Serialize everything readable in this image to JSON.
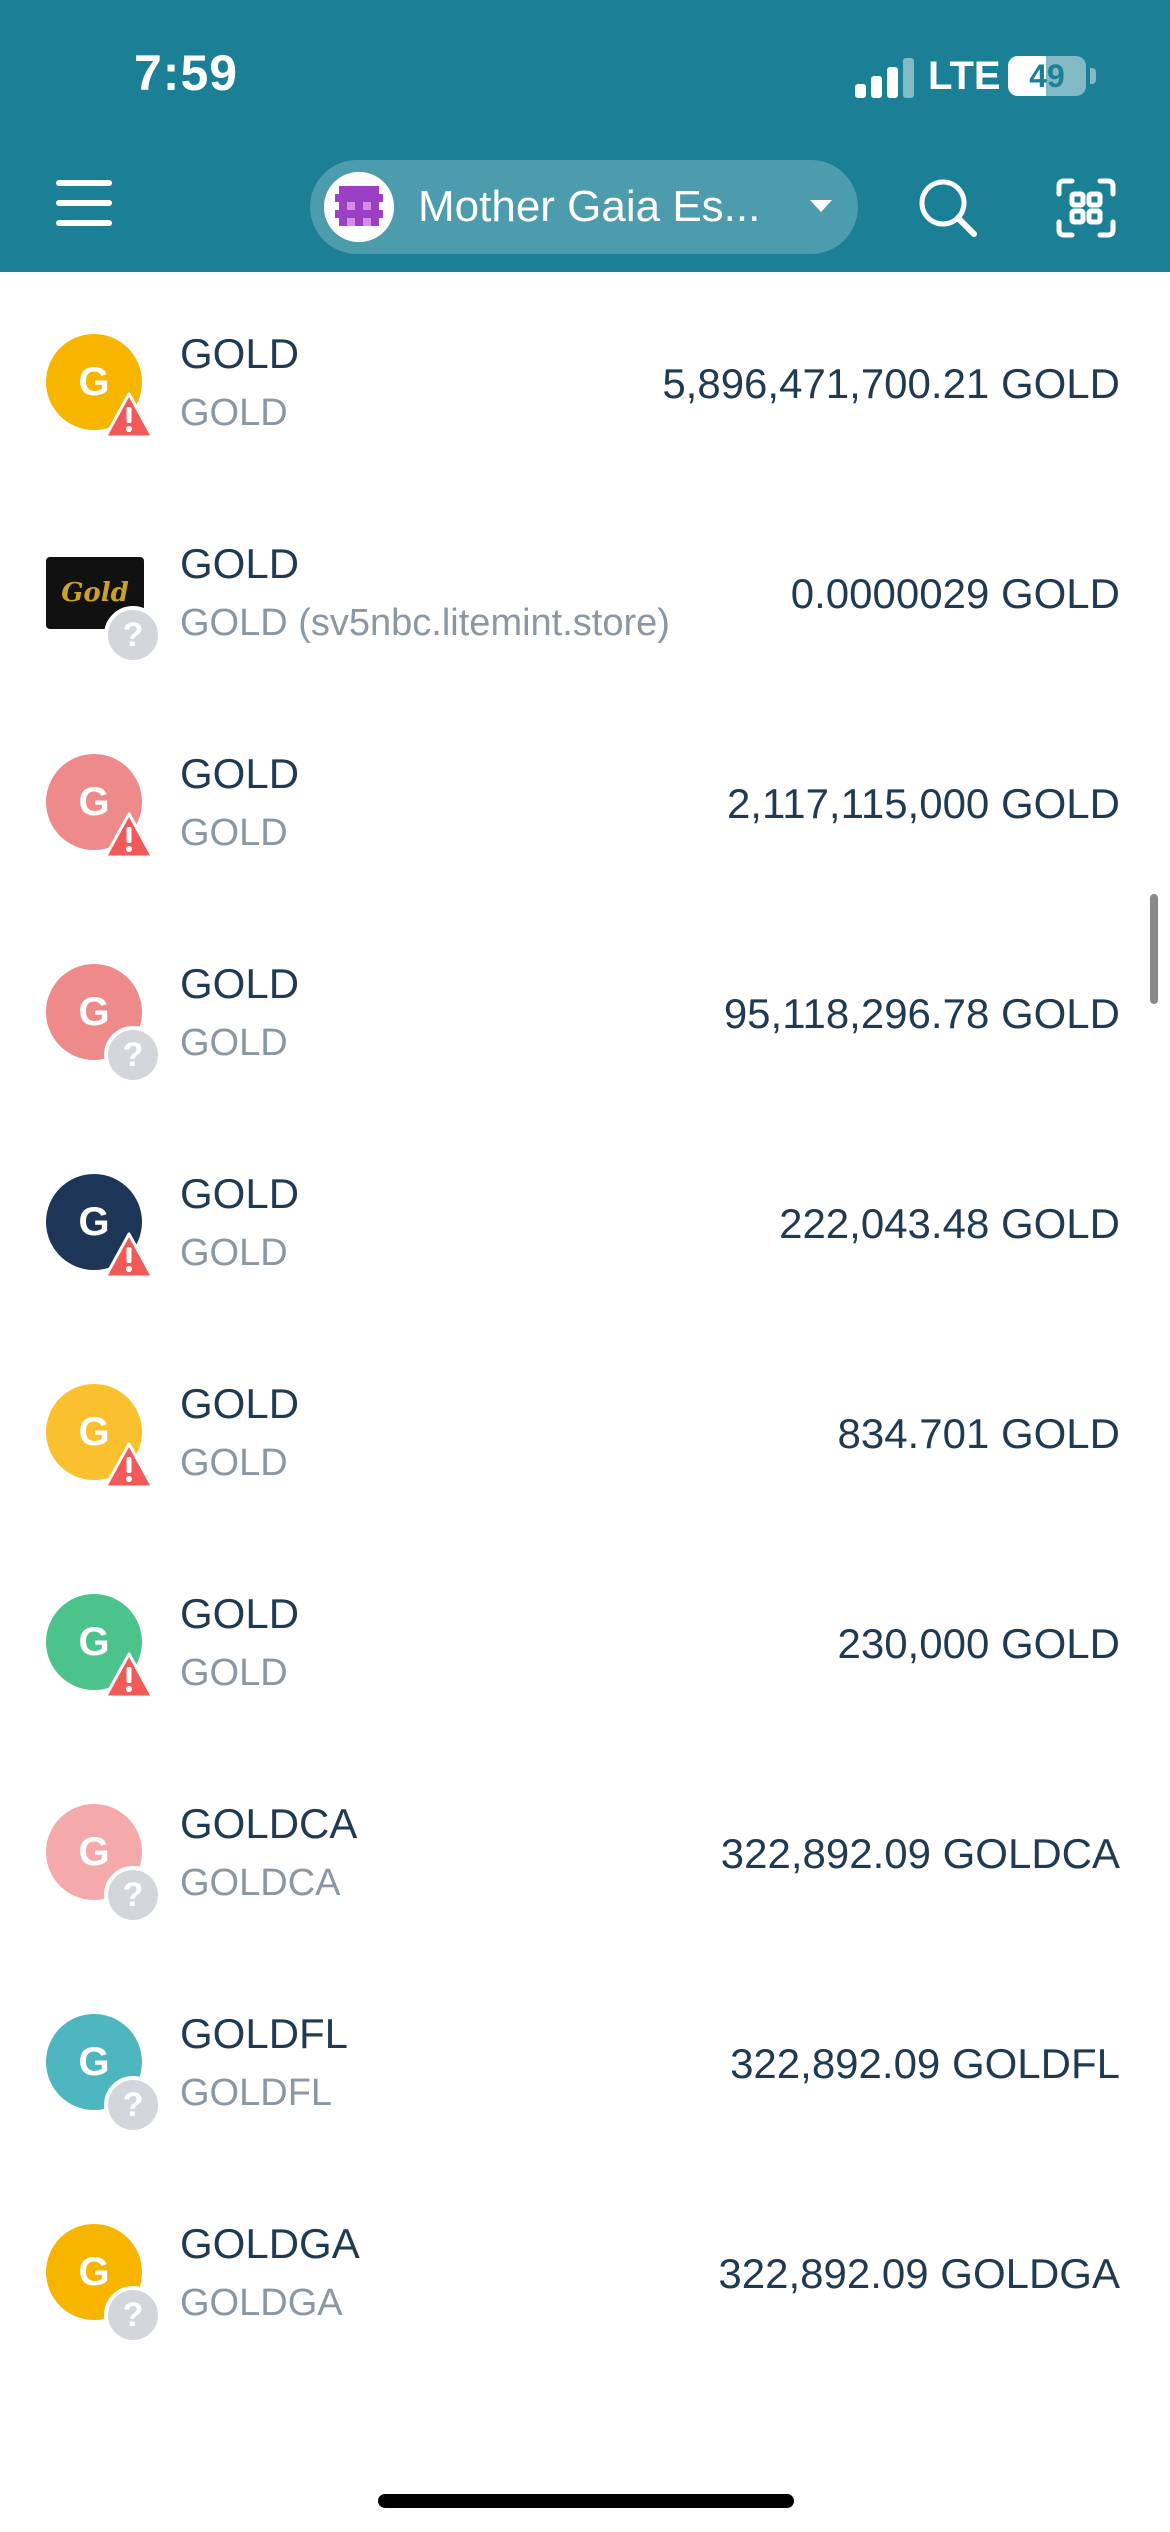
{
  "status_bar": {
    "time": "7:59",
    "network": "LTE",
    "battery": "49",
    "battery_level": 0.49
  },
  "header": {
    "wallet_name": "Mother Gaia Es...",
    "menu_icon": "hamburger-menu-icon",
    "search_icon": "search-icon",
    "scan_icon": "qr-scan-icon"
  },
  "colors": {
    "header_bg": "#1b8096",
    "warning": "#f25a5a",
    "unknown_badge": "#d3d7db"
  },
  "tokens": [
    {
      "name": "GOLD",
      "subtitle": "GOLD",
      "balance": "5,896,471,700.21 GOLD",
      "letter": "G",
      "color": "#f7b500",
      "badge": "warning"
    },
    {
      "name": "GOLD",
      "subtitle": "GOLD (sv5nbc.litemint.store)",
      "balance": "0.0000029 GOLD",
      "letter": "Gold",
      "color": "#111111",
      "badge": "unknown",
      "image": true
    },
    {
      "name": "GOLD",
      "subtitle": "GOLD",
      "balance": "2,117,115,000 GOLD",
      "letter": "G",
      "color": "#ee8a8a",
      "badge": "warning"
    },
    {
      "name": "GOLD",
      "subtitle": "GOLD",
      "balance": "95,118,296.78 GOLD",
      "letter": "G",
      "color": "#ee8a8a",
      "badge": "unknown"
    },
    {
      "name": "GOLD",
      "subtitle": "GOLD",
      "balance": "222,043.48 GOLD",
      "letter": "G",
      "color": "#1d3557",
      "badge": "warning"
    },
    {
      "name": "GOLD",
      "subtitle": "GOLD",
      "balance": "834.701 GOLD",
      "letter": "G",
      "color": "#fbc02d",
      "badge": "warning"
    },
    {
      "name": "GOLD",
      "subtitle": "GOLD",
      "balance": "230,000 GOLD",
      "letter": "G",
      "color": "#4cc38a",
      "badge": "warning"
    },
    {
      "name": "GOLDCA",
      "subtitle": "GOLDCA",
      "balance": "322,892.09 GOLDCA",
      "letter": "G",
      "color": "#f4aaaa",
      "badge": "unknown"
    },
    {
      "name": "GOLDFL",
      "subtitle": "GOLDFL",
      "balance": "322,892.09 GOLDFL",
      "letter": "G",
      "color": "#4db6bf",
      "badge": "unknown"
    },
    {
      "name": "GOLDGA",
      "subtitle": "GOLDGA",
      "balance": "322,892.09 GOLDGA",
      "letter": "G",
      "color": "#f7b500",
      "badge": "unknown"
    }
  ]
}
